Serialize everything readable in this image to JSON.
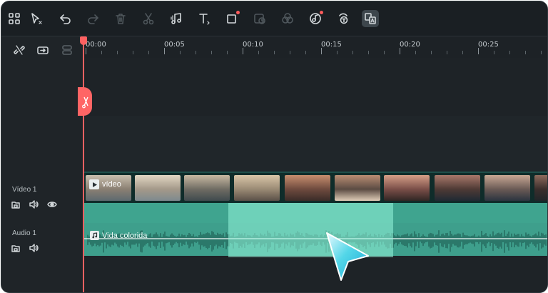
{
  "toolbar": {
    "items": [
      {
        "name": "grid-layout-icon",
        "enabled": true
      },
      {
        "name": "select-pointer-icon",
        "enabled": true
      },
      {
        "name": "undo-icon",
        "enabled": true
      },
      {
        "name": "redo-icon",
        "enabled": false
      },
      {
        "name": "delete-icon",
        "enabled": false
      },
      {
        "name": "scissors-icon",
        "enabled": false
      },
      {
        "name": "audio-music-icon",
        "enabled": true
      },
      {
        "name": "text-icon",
        "enabled": true
      },
      {
        "name": "crop-icon",
        "enabled": true,
        "badge": true
      },
      {
        "name": "speed-icon",
        "enabled": false
      },
      {
        "name": "color-icon",
        "enabled": false
      },
      {
        "name": "ai-audio-icon",
        "enabled": true,
        "badge": true
      },
      {
        "name": "text-to-speech-icon",
        "enabled": true
      },
      {
        "name": "translate-icon",
        "enabled": true,
        "active": true
      }
    ]
  },
  "left_tools": [
    {
      "name": "unlink-icon"
    },
    {
      "name": "link-clip-icon"
    },
    {
      "name": "group-icon"
    }
  ],
  "ruler": {
    "labels": [
      "00:00",
      "00:05",
      "00:10",
      "00:15",
      "00:20",
      "00:25"
    ]
  },
  "tracks": {
    "video": {
      "name": "Vídeo 1",
      "clip_label": "vídeo"
    },
    "audio": {
      "name": "Audio 1",
      "clip_label": "Vida colorida"
    }
  },
  "colors": {
    "accent": "#ff6161",
    "audio": "#3e9f8c",
    "selection": "#96f5dc",
    "cursor": "#2ec8e0"
  }
}
